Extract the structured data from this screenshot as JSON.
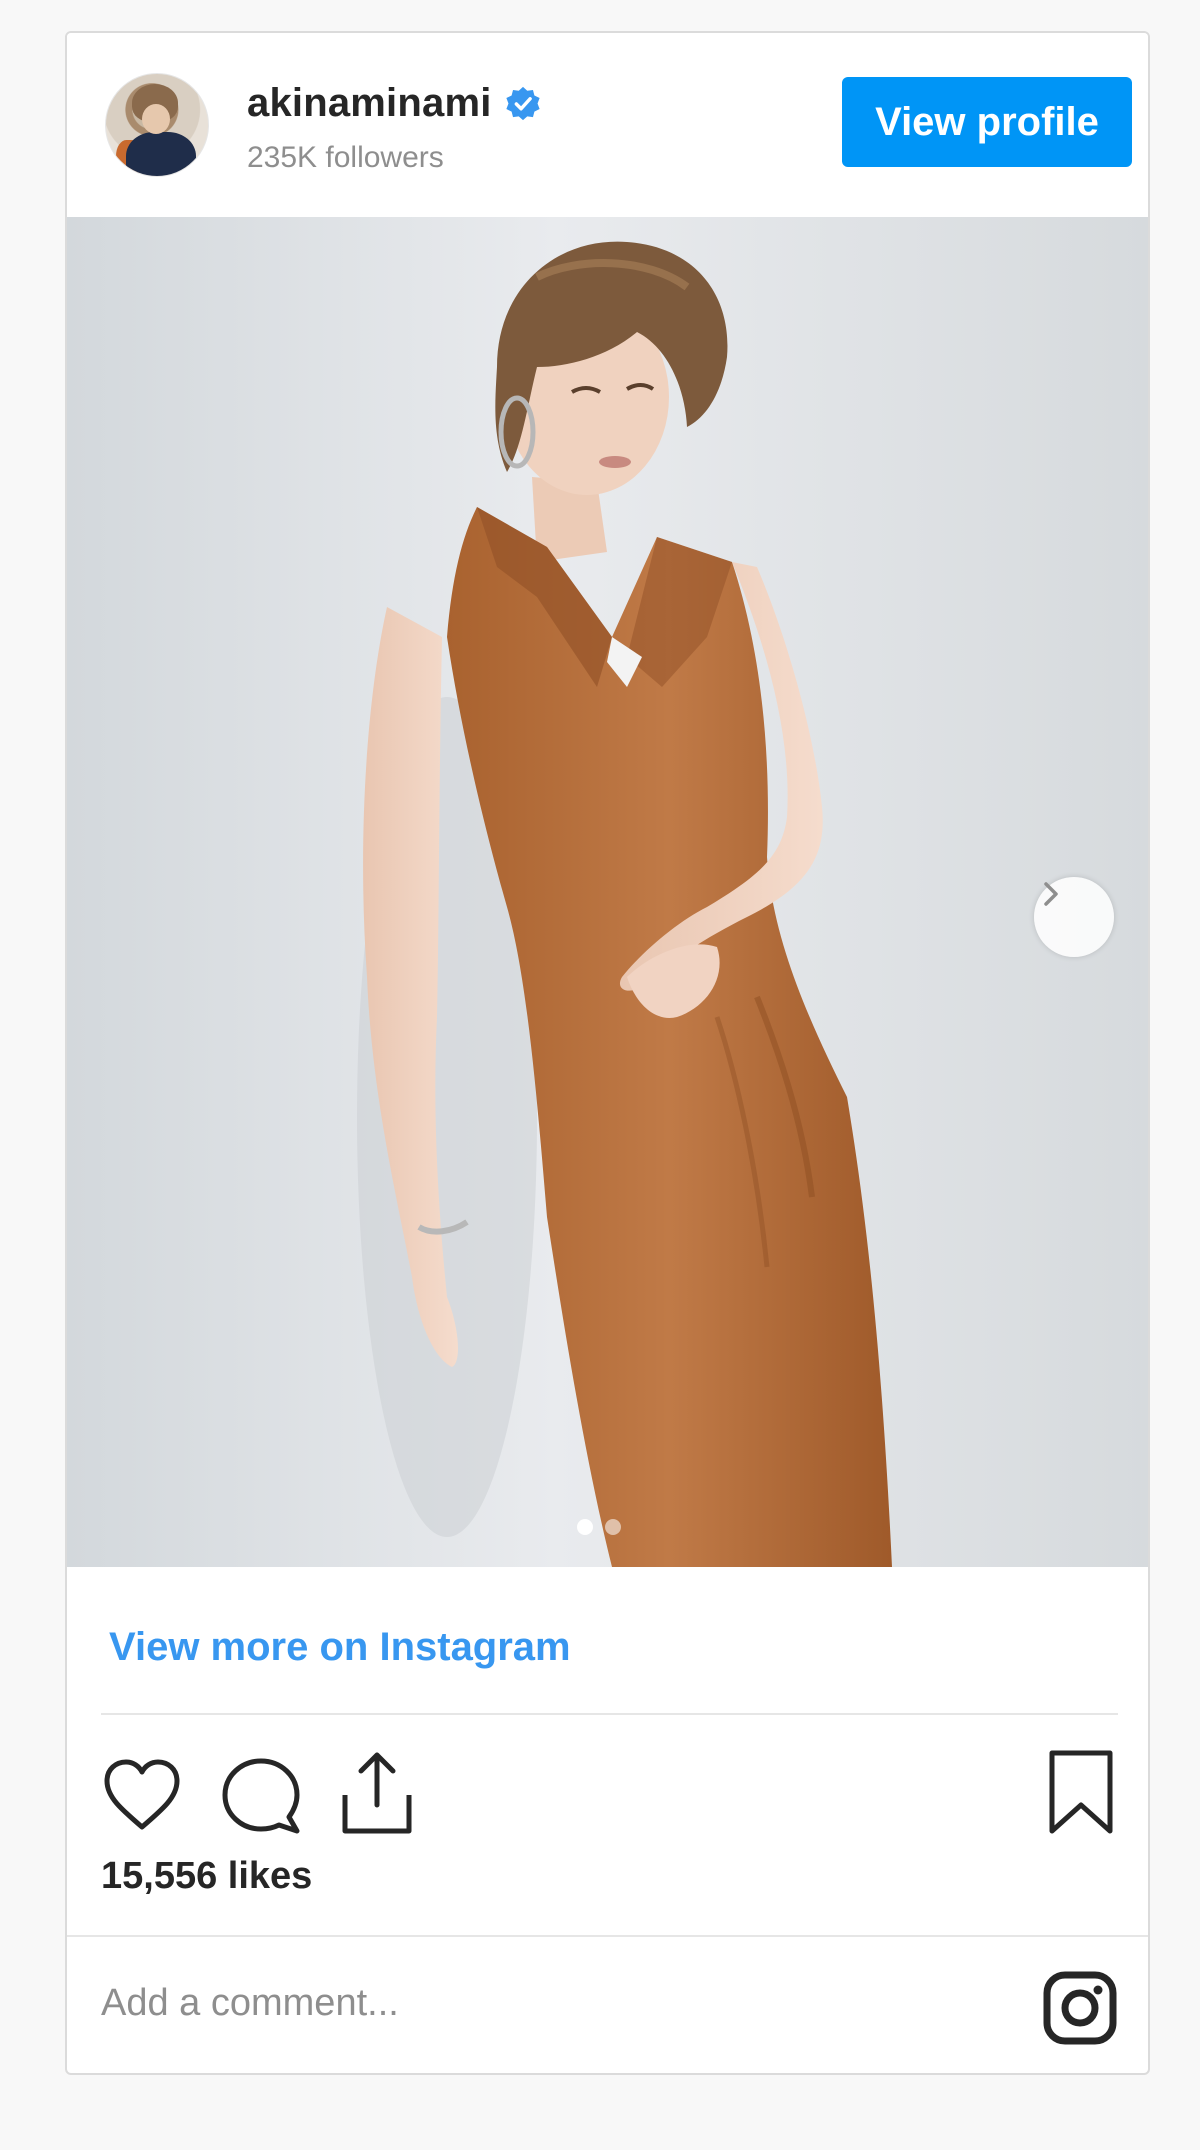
{
  "header": {
    "username": "akinaminami",
    "followers": "235K followers",
    "view_profile_label": "View profile"
  },
  "post": {
    "image_count": 2,
    "active_image_index": 1,
    "view_more_label": "View more on Instagram",
    "likes": "15,556 likes",
    "comment_placeholder": "Add a comment..."
  },
  "icons": {
    "verified": "verified-badge-icon",
    "like": "heart-icon",
    "comment": "comment-icon",
    "share": "share-icon",
    "save": "bookmark-icon",
    "next": "chevron-right-icon",
    "brand": "instagram-logo-icon"
  },
  "colors": {
    "accent": "#0095f6",
    "link": "#3897f0",
    "text": "#262626",
    "muted": "#8e8e8e",
    "border": "#dbdbdb",
    "dress": "#b9713f"
  }
}
